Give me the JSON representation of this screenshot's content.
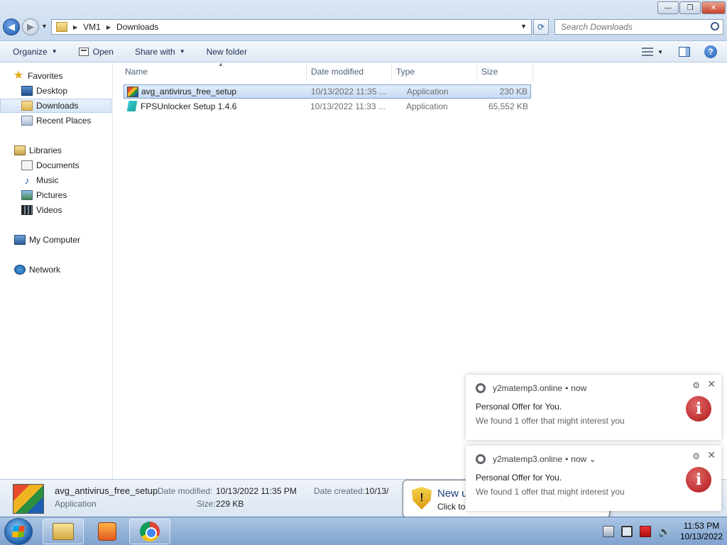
{
  "window": {
    "buttons": {
      "minimize": "—",
      "restore": "❐",
      "close": "✕"
    }
  },
  "address": {
    "crumbs": [
      "VM1",
      "Downloads"
    ],
    "search_placeholder": "Search Downloads"
  },
  "toolbar": {
    "organize": "Organize",
    "open": "Open",
    "share_with": "Share with",
    "new_folder": "New folder"
  },
  "nav": {
    "favorites": "Favorites",
    "desktop": "Desktop",
    "downloads": "Downloads",
    "recent_places": "Recent Places",
    "libraries": "Libraries",
    "documents": "Documents",
    "music": "Music",
    "pictures": "Pictures",
    "videos": "Videos",
    "my_computer": "My Computer",
    "network": "Network"
  },
  "columns": {
    "name": "Name",
    "date_modified": "Date modified",
    "type": "Type",
    "size": "Size"
  },
  "files": [
    {
      "name": "avg_antivirus_free_setup",
      "date": "10/13/2022 11:35 ...",
      "type": "Application",
      "size": "230 KB",
      "icon": "avg-icon"
    },
    {
      "name": "FPSUnlocker Setup 1.4.6",
      "date": "10/13/2022 11:33 ...",
      "type": "Application",
      "size": "65,552 KB",
      "icon": "fps-icon"
    }
  ],
  "details": {
    "name": "avg_antivirus_free_setup",
    "type": "Application",
    "date_modified_label": "Date modified:",
    "date_modified": "10/13/2022 11:35 PM",
    "size_label": "Size:",
    "size": "229 KB",
    "date_created_label": "Date created:",
    "date_created": "10/13/"
  },
  "balloon": {
    "title": "New u",
    "text": "Click to"
  },
  "toasts": [
    {
      "source": "y2matemp3.online",
      "time": "now",
      "chevron": "",
      "title": "Personal Offer for You.",
      "body": "We found 1 offer that might interest you"
    },
    {
      "source": "y2matemp3.online",
      "time": "now",
      "chevron": "⌄",
      "title": "Personal Offer for You.",
      "body": "We found 1 offer that might interest you"
    }
  ],
  "clock": {
    "time": "11:53 PM",
    "date": "10/13/2022"
  },
  "colors": {
    "selection": "#cce0f6",
    "accent": "#1d5bb2",
    "toast_info": "#b01515"
  }
}
